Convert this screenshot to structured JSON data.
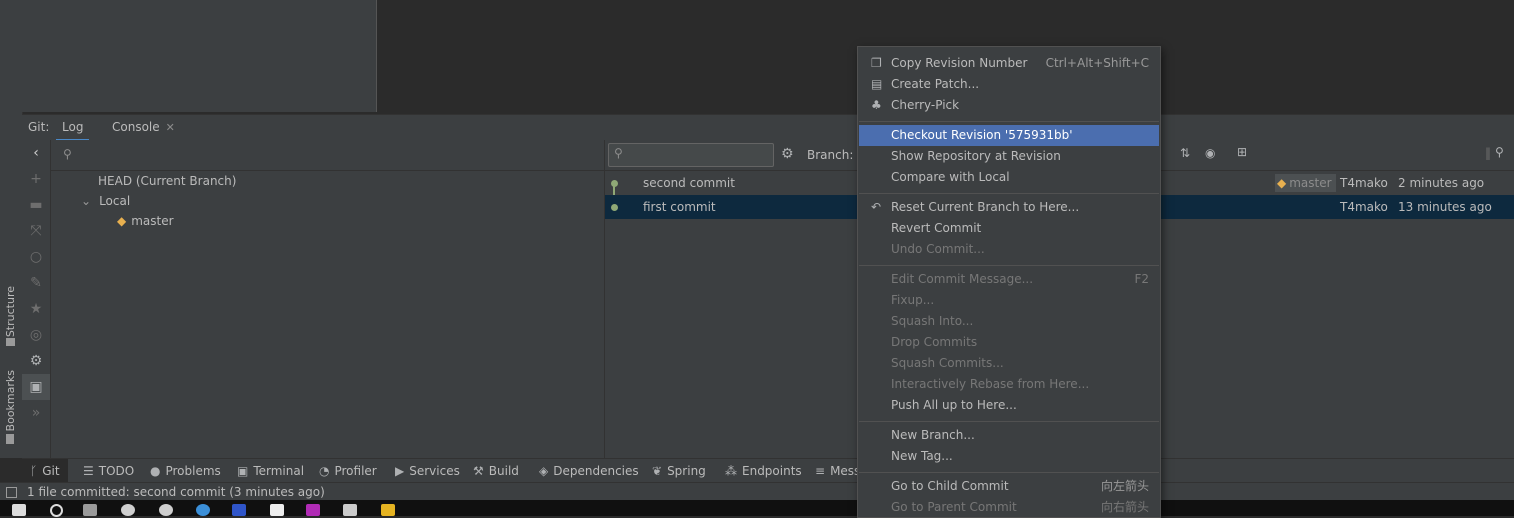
{
  "git_panel": {
    "title": "Git:",
    "tabs": [
      {
        "label": "Log"
      },
      {
        "label": "Console"
      }
    ],
    "close_glyph": "✕"
  },
  "side_labels": {
    "structure": "Structure",
    "bookmarks": "Bookmarks"
  },
  "branches": {
    "head": "HEAD (Current Branch)",
    "local": "Local",
    "master": "master"
  },
  "log": {
    "branch_label": "Branch:",
    "commits": [
      {
        "message": "second commit",
        "tag": "master",
        "author": "T4mako",
        "time": "2 minutes ago"
      },
      {
        "message": "first commit",
        "tag": "",
        "author": "T4mako",
        "time": "13 minutes ago"
      }
    ]
  },
  "context_menu": {
    "items": [
      {
        "label": "Copy Revision Number",
        "shortcut": "Ctrl+Alt+Shift+C",
        "icon": "copy-icon"
      },
      {
        "label": "Create Patch...",
        "shortcut": "",
        "icon": "patch-icon"
      },
      {
        "label": "Cherry-Pick",
        "shortcut": "",
        "icon": "cherry-icon"
      },
      {
        "label": "Checkout Revision '575931bb'",
        "shortcut": "",
        "icon": ""
      },
      {
        "label": "Show Repository at Revision",
        "shortcut": "",
        "icon": ""
      },
      {
        "label": "Compare with Local",
        "shortcut": "",
        "icon": ""
      },
      {
        "label": "Reset Current Branch to Here...",
        "shortcut": "",
        "icon": "undo-icon"
      },
      {
        "label": "Revert Commit",
        "shortcut": "",
        "icon": ""
      },
      {
        "label": "Undo Commit...",
        "shortcut": "",
        "icon": ""
      },
      {
        "label": "Edit Commit Message...",
        "shortcut": "F2",
        "icon": ""
      },
      {
        "label": "Fixup...",
        "shortcut": "",
        "icon": ""
      },
      {
        "label": "Squash Into...",
        "shortcut": "",
        "icon": ""
      },
      {
        "label": "Drop Commits",
        "shortcut": "",
        "icon": ""
      },
      {
        "label": "Squash Commits...",
        "shortcut": "",
        "icon": ""
      },
      {
        "label": "Interactively Rebase from Here...",
        "shortcut": "",
        "icon": ""
      },
      {
        "label": "Push All up to Here...",
        "shortcut": "",
        "icon": ""
      },
      {
        "label": "New Branch...",
        "shortcut": "",
        "icon": ""
      },
      {
        "label": "New Tag...",
        "shortcut": "",
        "icon": ""
      },
      {
        "label": "Go to Child Commit",
        "shortcut": "向左箭头",
        "icon": ""
      },
      {
        "label": "Go to Parent Commit",
        "shortcut": "向右箭头",
        "icon": ""
      }
    ]
  },
  "bottom_tabs": [
    {
      "label": "Git",
      "icon": "git-branch-icon"
    },
    {
      "label": "TODO",
      "icon": "list-icon"
    },
    {
      "label": "Problems",
      "icon": "problems-icon"
    },
    {
      "label": "Terminal",
      "icon": "terminal-icon"
    },
    {
      "label": "Profiler",
      "icon": "profiler-icon"
    },
    {
      "label": "Services",
      "icon": "services-icon"
    },
    {
      "label": "Build",
      "icon": "hammer-icon"
    },
    {
      "label": "Dependencies",
      "icon": "dependencies-icon"
    },
    {
      "label": "Spring",
      "icon": "spring-icon"
    },
    {
      "label": "Endpoints",
      "icon": "endpoints-icon"
    },
    {
      "label": "Mess",
      "icon": "messages-icon"
    }
  ],
  "status_bar": {
    "text": "1 file committed:  second commit (3 minutes ago)"
  },
  "colors": {
    "accent": "#4b6eaf",
    "selected_row": "#0d293e",
    "graph": "#8fa876",
    "tag": "#e8b04f"
  }
}
